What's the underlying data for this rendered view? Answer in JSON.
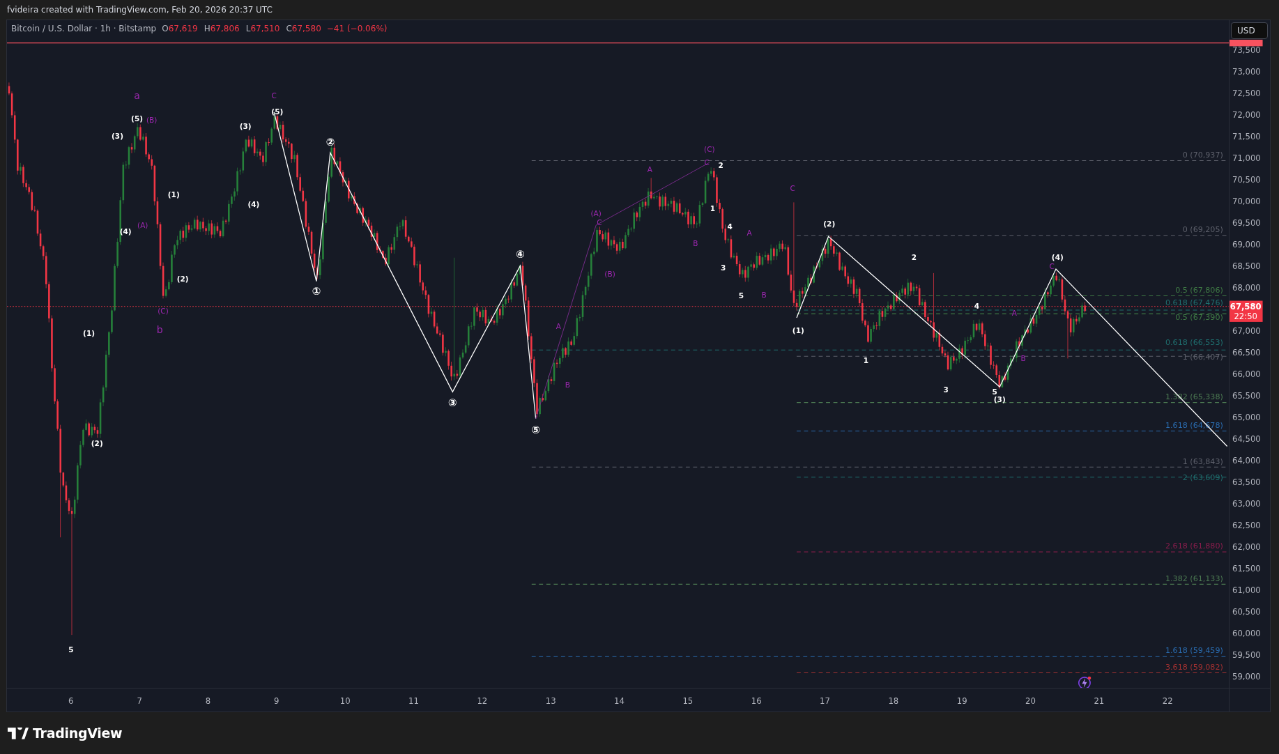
{
  "caption": "fvideira created with TradingView.com, Feb 20, 2026 20:37 UTC",
  "legend": {
    "symbol": "Bitcoin / U.S. Dollar · 1h · Bitstamp",
    "ohlc": [
      {
        "label": "O",
        "value": "67,619"
      },
      {
        "label": "H",
        "value": "67,806"
      },
      {
        "label": "L",
        "value": "67,510"
      },
      {
        "label": "C",
        "value": "67,580"
      }
    ],
    "change": "−41 (−0.06%)"
  },
  "currency_button": "USD",
  "price_axis": [
    "73,500",
    "73,000",
    "72,500",
    "72,000",
    "71,500",
    "71,000",
    "70,500",
    "70,000",
    "69,500",
    "69,000",
    "68,500",
    "68,000",
    "67,000",
    "66,500",
    "66,000",
    "65,500",
    "65,000",
    "64,500",
    "64,000",
    "63,500",
    "63,000",
    "62,500",
    "62,000",
    "61,500",
    "61,000",
    "60,500",
    "60,000",
    "59,500",
    "59,000"
  ],
  "last_price": {
    "price": "67,580",
    "countdown": "22:50"
  },
  "time_axis": [
    "6",
    "7",
    "8",
    "9",
    "10",
    "11",
    "12",
    "13",
    "14",
    "15",
    "16",
    "17",
    "18",
    "19",
    "20",
    "21",
    "22"
  ],
  "fib_levels": [
    {
      "label": "0 (70,937)",
      "color": "#5d606b"
    },
    {
      "label": "0 (69,205)",
      "color": "#5d606b"
    },
    {
      "label": "0.5 (67,806)",
      "color": "#3f7a45"
    },
    {
      "label": "0.618 (67,476)",
      "color": "#1f6f6f"
    },
    {
      "label": "0.5 (67,390)",
      "color": "#3f7a45"
    },
    {
      "label": "0.618 (66,553)",
      "color": "#1f6f6f"
    },
    {
      "label": "1 (66,407)",
      "color": "#5d606b"
    },
    {
      "label": "1.382 (65,338)",
      "color": "#4c7a52"
    },
    {
      "label": "1.618 (64,678)",
      "color": "#2a6cb0"
    },
    {
      "label": "1 (63,843)",
      "color": "#5d606b"
    },
    {
      "label": "2 (63,609)",
      "color": "#1f6f6f"
    },
    {
      "label": "2.618 (61,880)",
      "color": "#8b1d4d"
    },
    {
      "label": "1.382 (61,133)",
      "color": "#4c7a52"
    },
    {
      "label": "1.618 (59,459)",
      "color": "#2a6cb0"
    },
    {
      "label": "3.618 (59,082)",
      "color": "#a33131"
    }
  ],
  "wave_labels": [
    {
      "text": "a",
      "color": "#9c27b0"
    },
    {
      "text": "(3)",
      "color": "#ffffff"
    },
    {
      "text": "(5)",
      "color": "#ffffff"
    },
    {
      "text": "(B)",
      "color": "#9c27b0"
    },
    {
      "text": "(1)",
      "color": "#ffffff"
    },
    {
      "text": "(A)",
      "color": "#9c27b0"
    },
    {
      "text": "(4)",
      "color": "#ffffff"
    },
    {
      "text": "(2)",
      "color": "#ffffff"
    },
    {
      "text": "(C)",
      "color": "#9c27b0"
    },
    {
      "text": "b",
      "color": "#9c27b0"
    },
    {
      "text": "(1)",
      "color": "#ffffff"
    },
    {
      "text": "(2)",
      "color": "#ffffff"
    },
    {
      "text": "5",
      "color": "#ffffff"
    },
    {
      "text": "C",
      "color": "#9c27b0"
    },
    {
      "text": "(5)",
      "color": "#ffffff"
    },
    {
      "text": "(3)",
      "color": "#ffffff"
    },
    {
      "text": "(4)",
      "color": "#ffffff"
    },
    {
      "text": "②",
      "color": "#ffffff"
    },
    {
      "text": "①",
      "color": "#ffffff"
    },
    {
      "text": "④",
      "color": "#ffffff"
    },
    {
      "text": "③",
      "color": "#ffffff"
    },
    {
      "text": "⑤",
      "color": "#ffffff"
    },
    {
      "text": "(A)",
      "color": "#9c27b0"
    },
    {
      "text": "C",
      "color": "#9c27b0"
    },
    {
      "text": "(B)",
      "color": "#9c27b0"
    },
    {
      "text": "A",
      "color": "#9c27b0"
    },
    {
      "text": "B",
      "color": "#9c27b0"
    },
    {
      "text": "A",
      "color": "#9c27b0"
    },
    {
      "text": "B",
      "color": "#9c27b0"
    },
    {
      "text": "(C)",
      "color": "#9c27b0"
    },
    {
      "text": "C",
      "color": "#9c27b0"
    },
    {
      "text": "2",
      "color": "#ffffff"
    },
    {
      "text": "1",
      "color": "#ffffff"
    },
    {
      "text": "4",
      "color": "#ffffff"
    },
    {
      "text": "A",
      "color": "#9c27b0"
    },
    {
      "text": "3",
      "color": "#ffffff"
    },
    {
      "text": "5",
      "color": "#ffffff"
    },
    {
      "text": "B",
      "color": "#9c27b0"
    },
    {
      "text": "C",
      "color": "#9c27b0"
    },
    {
      "text": "(2)",
      "color": "#ffffff"
    },
    {
      "text": "(1)",
      "color": "#ffffff"
    },
    {
      "text": "1",
      "color": "#ffffff"
    },
    {
      "text": "2",
      "color": "#ffffff"
    },
    {
      "text": "4",
      "color": "#ffffff"
    },
    {
      "text": "A",
      "color": "#9c27b0"
    },
    {
      "text": "B",
      "color": "#9c27b0"
    },
    {
      "text": "3",
      "color": "#ffffff"
    },
    {
      "text": "5",
      "color": "#ffffff"
    },
    {
      "text": "(3)",
      "color": "#ffffff"
    },
    {
      "text": "C",
      "color": "#9c27b0"
    },
    {
      "text": "(4)",
      "color": "#ffffff"
    }
  ],
  "brand": "TradingView"
}
